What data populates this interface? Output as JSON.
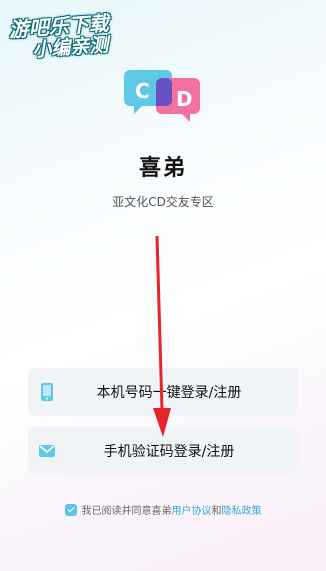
{
  "header": {
    "back_icon": "chevron-left-icon"
  },
  "watermark": {
    "line1": "游吧乐下载",
    "line2": "小编亲测"
  },
  "logo": {
    "text": "CD",
    "left_color": "#5ec8e6",
    "right_color": "#f06a9c"
  },
  "app": {
    "name": "喜弟",
    "tagline": "亚文化CD交友专区"
  },
  "login": {
    "one_click_label": "本机号码一键登录/注册",
    "one_click_icon": "phone-icon",
    "sms_label": "手机验证码登录/注册",
    "sms_icon": "mail-icon"
  },
  "agreement": {
    "prefix": "我已阅读并同意喜弟",
    "user_agreement": "用户协议",
    "and": "和",
    "privacy_policy": "隐私政策",
    "checked": true
  },
  "colors": {
    "accent": "#3aa7d6",
    "arrow": "#e8242b"
  }
}
